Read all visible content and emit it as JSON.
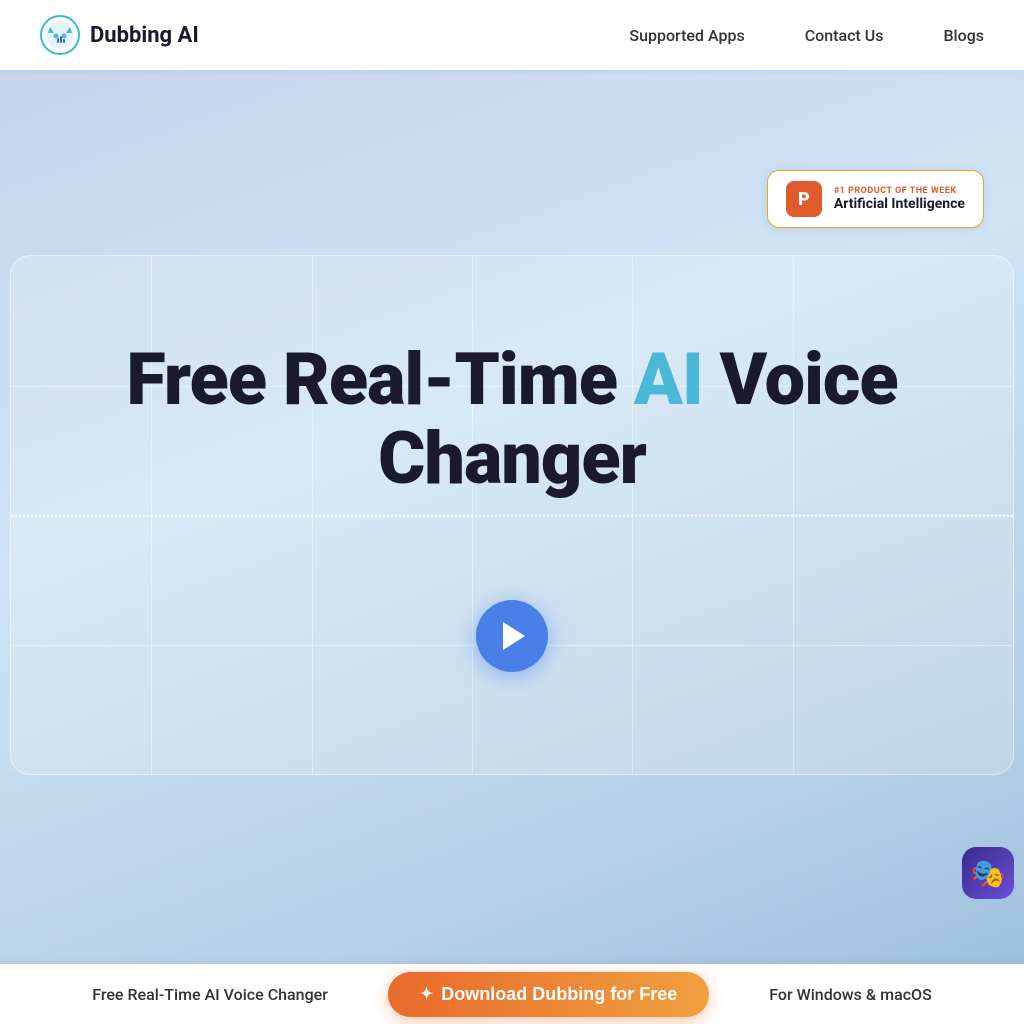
{
  "header": {
    "logo_text": "Dubbing AI",
    "nav": {
      "supported_apps": "Supported Apps",
      "contact_us": "Contact Us",
      "blogs": "Blogs"
    }
  },
  "badge": {
    "rank_text": "#1 PRODUCT OF THE WEEK",
    "category": "Artificial Intelligence",
    "p_letter": "P"
  },
  "hero": {
    "title_part1": "Free Real-Time ",
    "title_ai": "AI",
    "title_part2": " Voice Changer"
  },
  "bottom_bar": {
    "left_text": "Free Real-Time AI Voice Changer",
    "download_button": "Download Dubbing for Free",
    "right_text": "For Windows & macOS"
  },
  "grid": {
    "v_lines": [
      14,
      30,
      46,
      62,
      78
    ],
    "h_lines": [
      20,
      40,
      60,
      80
    ]
  }
}
